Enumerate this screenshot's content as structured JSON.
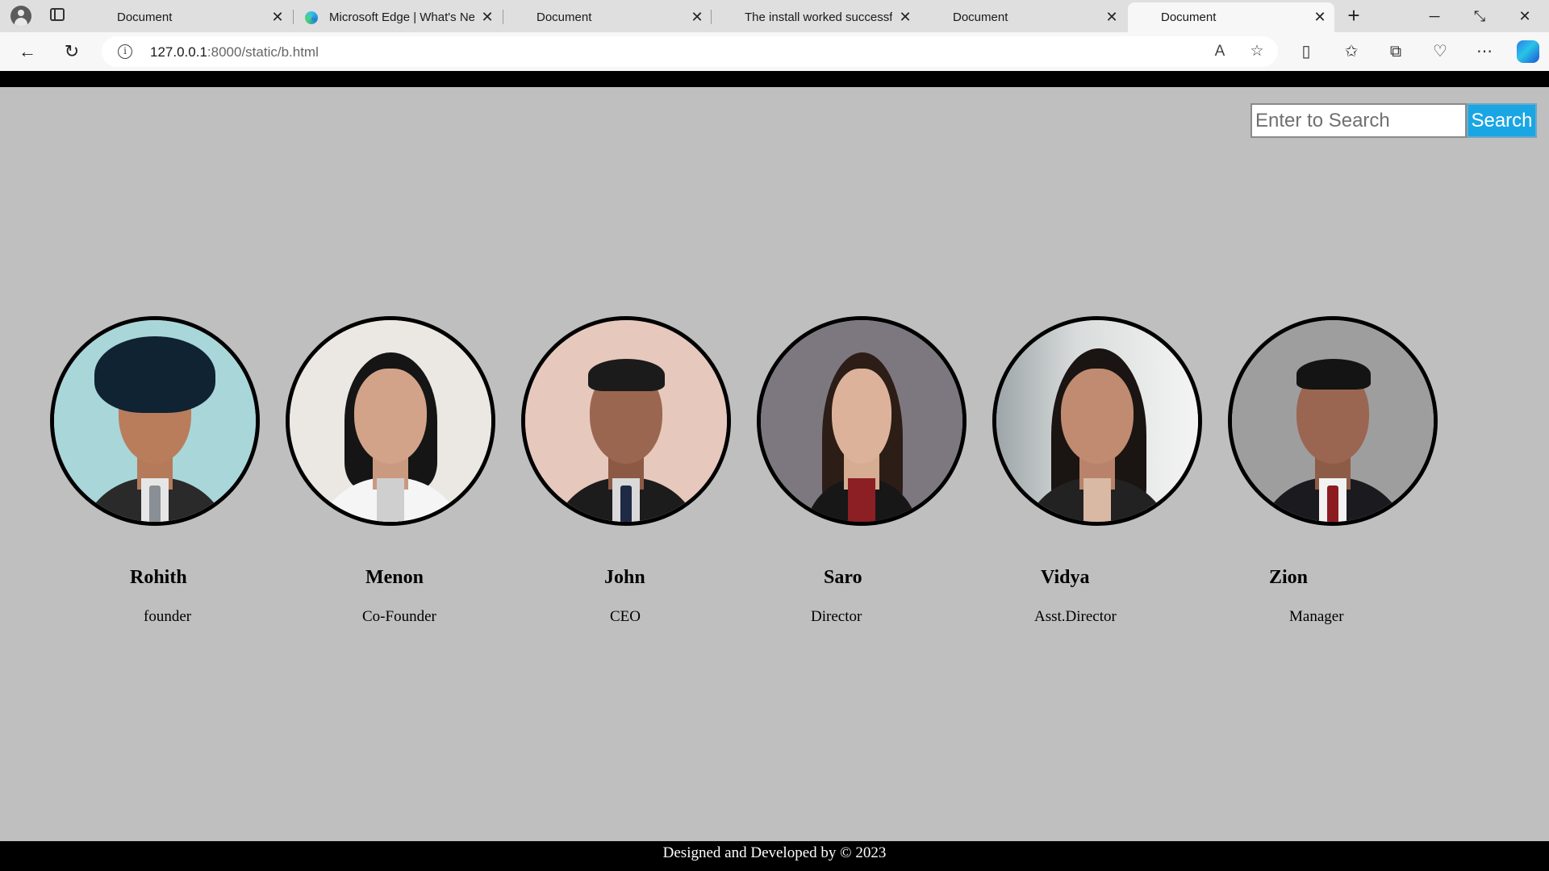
{
  "browser": {
    "tabs": [
      {
        "label": "Document",
        "icon": "page-icon",
        "active": false
      },
      {
        "label": "Microsoft Edge | What's Ne",
        "icon": "edge-icon",
        "active": false
      },
      {
        "label": "Document",
        "icon": "page-icon",
        "active": false
      },
      {
        "label": "The install worked successf",
        "icon": "page-icon",
        "active": false
      },
      {
        "label": "Document",
        "icon": "page-icon",
        "active": false
      },
      {
        "label": "Document",
        "icon": "page-icon",
        "active": true
      }
    ],
    "new_tab_label": "+",
    "url_host": "127.0.0.1",
    "url_rest": ":8000/static/b.html"
  },
  "search": {
    "placeholder": "Enter to Search",
    "button_label": "Search"
  },
  "team": [
    {
      "name": "Rohith",
      "role": "founder"
    },
    {
      "name": "Menon",
      "role": "Co-Founder"
    },
    {
      "name": "John",
      "role": "CEO"
    },
    {
      "name": "Saro",
      "role": "Director"
    },
    {
      "name": "Vidya",
      "role": "Asst.Director"
    },
    {
      "name": "Zion",
      "role": "Manager"
    }
  ],
  "footer": {
    "text": "Designed and Developed by © 2023"
  },
  "colors": {
    "page_background": "#bfbfbf",
    "search_button": "#1aa6e4",
    "bars": "#000000"
  }
}
